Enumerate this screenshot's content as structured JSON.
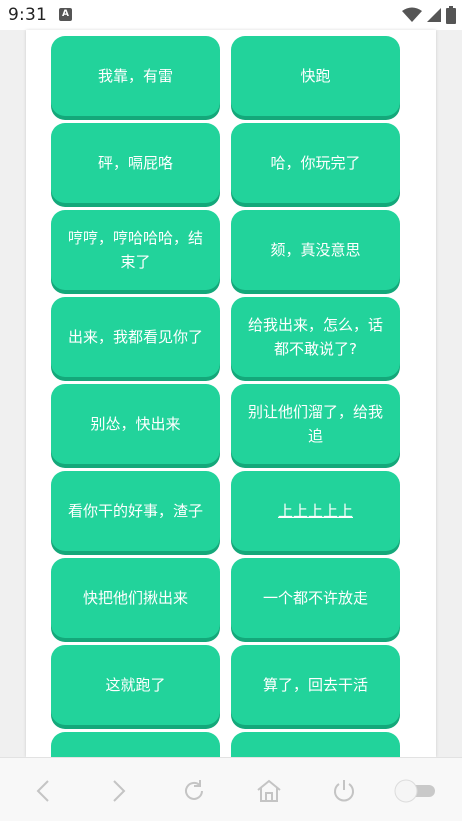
{
  "status_bar": {
    "time": "9:31",
    "app_badge": "A"
  },
  "buttons": [
    {
      "label": "我靠，有雷"
    },
    {
      "label": "快跑"
    },
    {
      "label": "砰，嗝屁咯"
    },
    {
      "label": "哈，你玩完了"
    },
    {
      "label": "哼哼，哼哈哈哈，结束了"
    },
    {
      "label": "颏，真没意思"
    },
    {
      "label": "出来，我都看见你了"
    },
    {
      "label": "给我出来，怎么，话都不敢说了?"
    },
    {
      "label": "别怂，快出来"
    },
    {
      "label": "别让他们溜了，给我追"
    },
    {
      "label": "看你干的好事，渣子"
    },
    {
      "label": "上上上上上"
    },
    {
      "label": "快把他们揪出来"
    },
    {
      "label": "一个都不许放走"
    },
    {
      "label": "这就跑了"
    },
    {
      "label": "算了，回去干活"
    },
    {
      "label": ""
    },
    {
      "label": ""
    }
  ],
  "bottom_nav": {
    "icons": [
      "back-icon",
      "forward-icon",
      "refresh-icon",
      "home-icon",
      "power-icon",
      "toggle-icon"
    ]
  },
  "colors": {
    "button": "#22d39b",
    "button_shadow": "#14a87a",
    "nav_icon": "#c4c4c4"
  }
}
